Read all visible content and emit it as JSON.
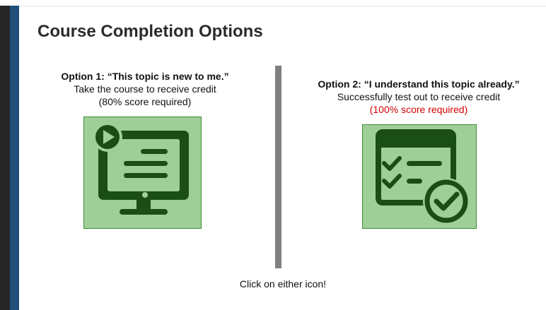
{
  "slide": {
    "title": "Course Completion Options",
    "option1": {
      "heading": "Option 1: “This topic is new to me.”",
      "line1": "Take the course to receive credit",
      "line2": "(80% score required)",
      "icon": "computer-play-icon"
    },
    "option2": {
      "heading": "Option 2: “I understand this topic already.”",
      "line1": "Successfully test out to receive credit",
      "line2": "(100% score required)",
      "icon": "checklist-test-icon"
    },
    "footer": "Click on either icon!"
  },
  "colors": {
    "accent_blue": "#1f4e79",
    "tile_fill": "#9fce97",
    "icon_dark_green": "#1b4d16",
    "required_red": "#d40000",
    "divider_gray": "#7f7f7f"
  }
}
